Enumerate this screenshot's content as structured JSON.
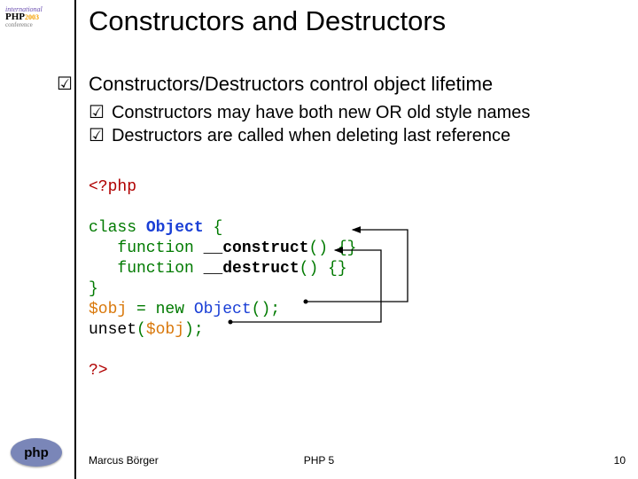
{
  "conf_logo": {
    "line1": "international",
    "line2_a": "PHP",
    "line2_b": "2003",
    "line3": "conference"
  },
  "title": "Constructors and Destructors",
  "check_glyph": "☑",
  "heading": "Constructors/Destructors control object lifetime",
  "sub_bullets": [
    "Constructors may have both new OR old style names",
    "Destructors are called when deleting last reference"
  ],
  "code": {
    "open": "<?php",
    "l1a": "class ",
    "l1b": "Object ",
    "l1c": "{",
    "l2a": "   function ",
    "l2b": "__construct",
    "l2c": "() {}",
    "l3a": "   function ",
    "l3b": "__destruct",
    "l3c": "() {}",
    "l4": "}",
    "l5a": "$obj ",
    "l5b": "= new ",
    "l5c": "Object",
    "l5d": "();",
    "l6a": "unset",
    "l6b": "(",
    "l6c": "$obj",
    "l6d": ");",
    "close": "?>"
  },
  "footer": {
    "left": "Marcus Börger",
    "center": "PHP 5",
    "right": "10"
  },
  "php_logo": "php"
}
